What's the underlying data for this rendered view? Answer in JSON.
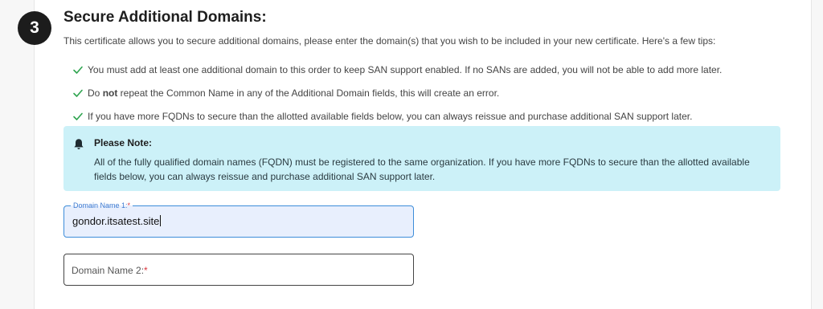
{
  "step": {
    "number": "3"
  },
  "section": {
    "title": "Secure Additional Domains:",
    "intro": "This certificate allows you to secure additional domains, please enter the domain(s) that you wish to be included in your new certificate. Here's a few tips:"
  },
  "tips": [
    {
      "text": "You must add at least one additional domain to this order to keep SAN support enabled. If no SANs are added, you will not be able to add more later."
    },
    {
      "pre": "Do ",
      "bold": "not",
      "post": " repeat the Common Name in any of the Additional Domain fields, this will create an error."
    },
    {
      "text": "If you have more FQDNs to secure than the allotted available fields below, you can always reissue and purchase additional SAN support later."
    }
  ],
  "note": {
    "title": "Please Note:",
    "text": "All of the fully qualified domain names (FQDN) must be registered to the same organization. If you have more FQDNs to secure than the allotted available fields below, you can always reissue and purchase additional SAN support later."
  },
  "fields": [
    {
      "label": "Domain Name 1:",
      "required_mark": "*",
      "value": "gondor.itsatest.site"
    },
    {
      "label": "Domain Name 2:",
      "required_mark": "*",
      "value": ""
    }
  ],
  "colors": {
    "check": "#2ea44f",
    "note_bg": "#ccf1f8",
    "focus_border": "#3d8dd9",
    "required": "#d9363e"
  }
}
